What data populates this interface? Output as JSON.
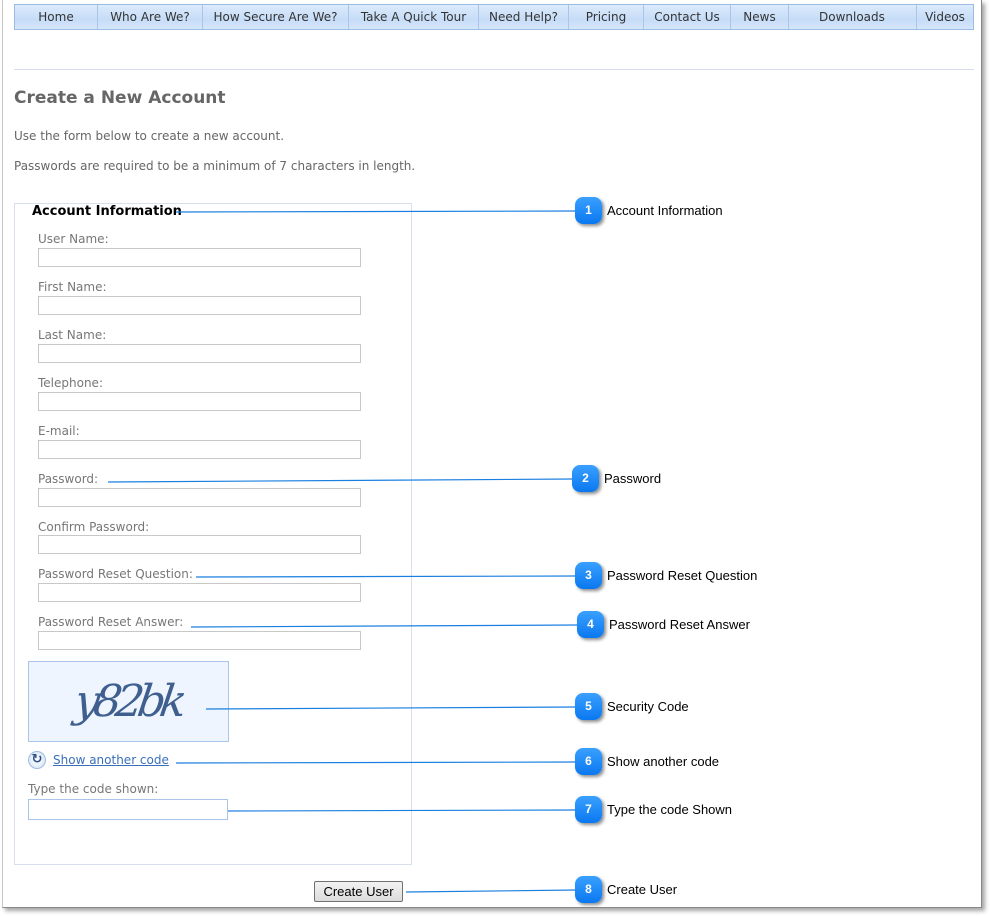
{
  "nav": {
    "items": [
      {
        "label": "Home"
      },
      {
        "label": "Who Are We?"
      },
      {
        "label": "How Secure Are We?"
      },
      {
        "label": "Take A Quick Tour"
      },
      {
        "label": "Need Help?"
      },
      {
        "label": "Pricing"
      },
      {
        "label": "Contact Us"
      },
      {
        "label": "News"
      },
      {
        "label": "Downloads"
      },
      {
        "label": "Videos"
      }
    ]
  },
  "page": {
    "title": "Create a New Account",
    "intro": "Use the form below to create a new account.",
    "password_note": "Passwords are required to be a minimum of 7 characters in length."
  },
  "form": {
    "legend": "Account Information",
    "fields": [
      {
        "label": "User Name:",
        "value": ""
      },
      {
        "label": "First Name:",
        "value": ""
      },
      {
        "label": "Last Name:",
        "value": ""
      },
      {
        "label": "Telephone:",
        "value": ""
      },
      {
        "label": "E-mail:",
        "value": ""
      },
      {
        "label": "Password:",
        "value": ""
      },
      {
        "label": "Confirm Password:",
        "value": ""
      },
      {
        "label": "Password Reset Question:",
        "value": ""
      },
      {
        "label": "Password Reset Answer:",
        "value": ""
      }
    ],
    "captcha_text": "y82bk",
    "show_another_code": "Show another code",
    "code_label": "Type the code shown:",
    "code_value": "",
    "submit_label": "Create User"
  },
  "callouts": [
    {
      "number": "1",
      "text": "Account Information"
    },
    {
      "number": "2",
      "text": "Password"
    },
    {
      "number": "3",
      "text": "Password Reset Question"
    },
    {
      "number": "4",
      "text": "Password Reset Answer"
    },
    {
      "number": "5",
      "text": "Security Code"
    },
    {
      "number": "6",
      "text": "Show another code"
    },
    {
      "number": "7",
      "text": "Type the code Shown"
    },
    {
      "number": "8",
      "text": "Create User"
    }
  ],
  "colors": {
    "callout_blue": "#0a78f0",
    "nav_background": "#c6dcf7",
    "link_blue": "#3a6fb8"
  }
}
